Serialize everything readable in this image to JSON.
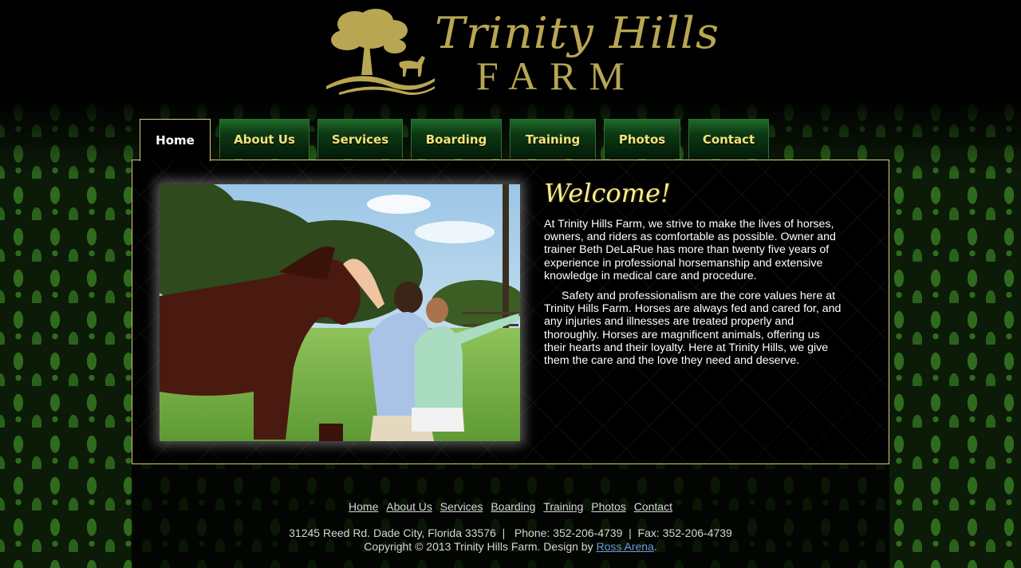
{
  "header": {
    "logo_script": "Trinity Hills",
    "logo_farm": "FARM"
  },
  "nav": {
    "tabs": [
      {
        "label": "Home",
        "active": true
      },
      {
        "label": "About Us"
      },
      {
        "label": "Services"
      },
      {
        "label": "Boarding"
      },
      {
        "label": "Training"
      },
      {
        "label": "Photos"
      },
      {
        "label": "Contact"
      }
    ]
  },
  "main": {
    "heading": "Welcome!",
    "paragraph1": "At Trinity Hills Farm, we strive to make the lives of horses, owners, and riders as comfortable as possible. Owner and trainer Beth DeLaRue has more than twenty five years of experience in professional horsemanship and extensive knowledge in medical care and procedure.",
    "paragraph2": "Safety and professionalism are the core values here at Trinity Hills Farm. Horses are always fed and cared for, and any injuries and illnesses are treated properly and thoroughly. Horses are magnificent animals, offering us their hearts and their loyalty. Here at Trinity Hills, we give them the care and the love they need and deserve."
  },
  "footer": {
    "links": [
      "Home",
      "About Us",
      "Services",
      "Boarding",
      "Training",
      "Photos",
      "Contact"
    ],
    "address": "31245 Reed Rd. Dade City, Florida 33576  |   Phone: 352-206-4739  |  Fax: 352-206-4739",
    "copyright": "Copyright © 2013 Trinity Hills Farm. Design by",
    "designer": "Ross Arena",
    "end": "."
  },
  "colors": {
    "accent_gold": "#d8cc76",
    "tab_text": "#f4e27c",
    "link_blue": "#6e9fd8"
  }
}
